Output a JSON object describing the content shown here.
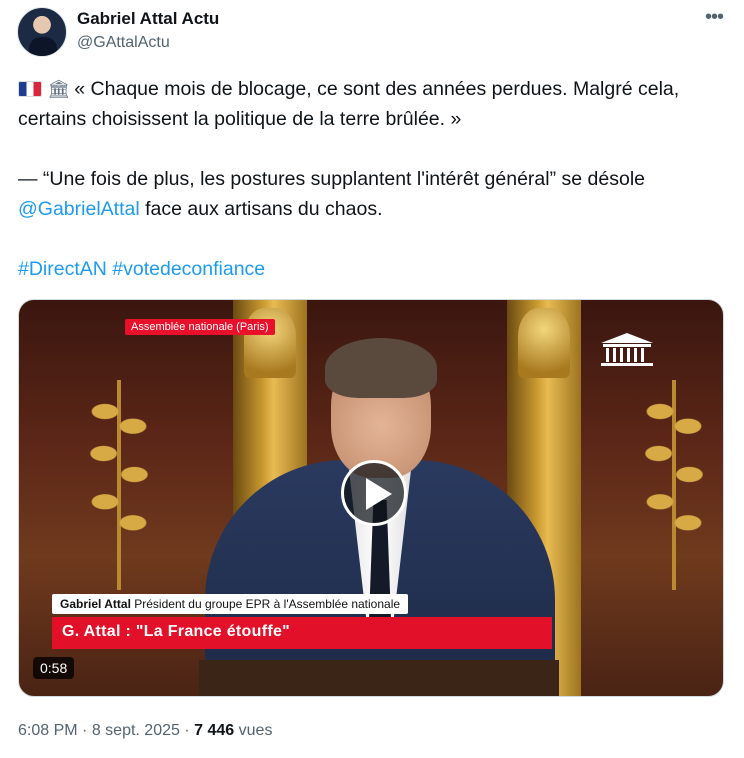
{
  "author": {
    "name": "Gabriel Attal Actu",
    "handle": "@GAttalActu"
  },
  "icons": [
    "flag-france-icon",
    "government-building-icon",
    "more-options-icon",
    "play-icon"
  ],
  "tweet": {
    "quote_text": "« Chaque mois de blocage, ce sont des années perdues. Malgré cela, certains choisissent la politique de la terre brûlée. »",
    "second_text_before": "— “Une fois de plus, les postures supplantent l'intérêt général” se désole ",
    "mention": "@GabrielAttal",
    "second_text_after": " face aux artisans du chaos.",
    "hashtag_1": "#DirectAN",
    "hashtag_2": "#votedeconfiance"
  },
  "video": {
    "location_badge": "Assemblée nationale (Paris)",
    "speaker_name": "Gabriel Attal",
    "speaker_title": "Président du groupe EPR à l'Assemblée nationale",
    "headline": "G. Attal : \"La France étouffe\"",
    "duration": "0:58"
  },
  "meta": {
    "time": "6:08 PM",
    "separator": "·",
    "date": "8 sept. 2025",
    "views_count": "7 446",
    "views_label": "vues"
  },
  "colors": {
    "link": "#1d9bf0",
    "secondary_text": "#536471",
    "primary_text": "#0f1419",
    "headline_red": "#e3102a"
  }
}
